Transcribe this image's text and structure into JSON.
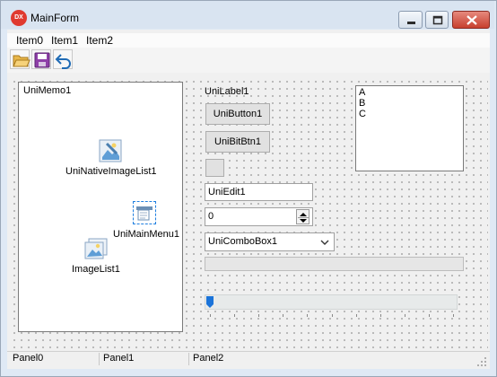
{
  "window": {
    "title": "MainForm",
    "logo_text": "DX"
  },
  "menu": {
    "items": [
      "Item0",
      "Item1",
      "Item2"
    ]
  },
  "toolbar": {
    "buttons": [
      "open-folder-icon",
      "save-icon",
      "undo-icon"
    ]
  },
  "memo": {
    "text": "UniMemo1"
  },
  "nonvisual": {
    "native_image_list": "UniNativeImageList1",
    "main_menu": "UniMainMenu1",
    "image_list": "ImageList1"
  },
  "label": {
    "text": "UniLabel1"
  },
  "buttons": {
    "uni_button": "UniButton1",
    "uni_bit_btn": "UniBitBtn1"
  },
  "edit": {
    "value": "UniEdit1"
  },
  "spin": {
    "value": "0"
  },
  "combo": {
    "value": "UniComboBox1"
  },
  "progress": {
    "value": 0
  },
  "trackbar": {
    "position": 0
  },
  "listbox": {
    "items": [
      "A",
      "B",
      "C"
    ]
  },
  "statusbar": {
    "panels": [
      "Panel0",
      "Panel1",
      "Panel2"
    ]
  },
  "colors": {
    "close_button": "#c7402f",
    "logo": "#e03a30",
    "thumb": "#1a73d9"
  }
}
